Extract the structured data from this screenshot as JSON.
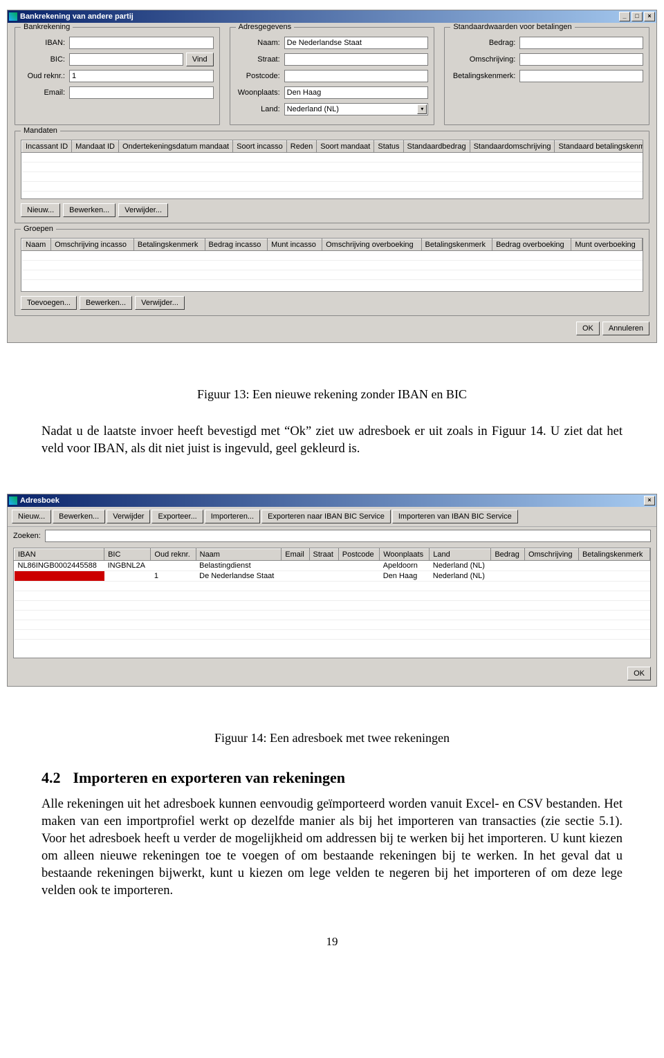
{
  "figure13": {
    "window_title": "Bankrekening van andere partij",
    "groups": {
      "bankrekening": {
        "title": "Bankrekening",
        "fields": {
          "iban_label": "IBAN:",
          "iban_value": "",
          "bic_label": "BIC:",
          "bic_value": "",
          "vind_btn": "Vind",
          "oudreknr_label": "Oud reknr.:",
          "oudreknr_value": "1",
          "email_label": "Email:",
          "email_value": ""
        }
      },
      "adres": {
        "title": "Adresgegevens",
        "fields": {
          "naam_label": "Naam:",
          "naam_value": "De Nederlandse Staat",
          "straat_label": "Straat:",
          "straat_value": "",
          "postcode_label": "Postcode:",
          "postcode_value": "",
          "woonplaats_label": "Woonplaats:",
          "woonplaats_value": "Den Haag",
          "land_label": "Land:",
          "land_value": "Nederland (NL)"
        }
      },
      "standaard": {
        "title": "Standaardwaarden voor betalingen",
        "fields": {
          "bedrag_label": "Bedrag:",
          "bedrag_value": "",
          "omschrijving_label": "Omschrijving:",
          "omschrijving_value": "",
          "betkenm_label": "Betalingskenmerk:",
          "betkenm_value": ""
        }
      },
      "mandaten": {
        "title": "Mandaten",
        "cols": [
          "Incassant ID",
          "Mandaat ID",
          "Ondertekeningsdatum mandaat",
          "Soort incasso",
          "Reden",
          "Soort mandaat",
          "Status",
          "Standaardbedrag",
          "Standaardomschrijving",
          "Standaard betalingskenmerk"
        ],
        "btns": {
          "nieuw": "Nieuw...",
          "bewerken": "Bewerken...",
          "verwijder": "Verwijder..."
        }
      },
      "groepen": {
        "title": "Groepen",
        "cols": [
          "Naam",
          "Omschrijving incasso",
          "Betalingskenmerk",
          "Bedrag incasso",
          "Munt incasso",
          "Omschrijving overboeking",
          "Betalingskenmerk",
          "Bedrag overboeking",
          "Munt overboeking"
        ],
        "btns": {
          "toevoegen": "Toevoegen...",
          "bewerken": "Bewerken...",
          "verwijder": "Verwijder..."
        }
      }
    },
    "ok_btn": "OK",
    "cancel_btn": "Annuleren",
    "caption": "Figuur 13: Een nieuwe rekening zonder IBAN en BIC"
  },
  "para1": "Nadat u de laatste invoer heeft bevestigd met “Ok” ziet uw adresboek er uit zoals in Figuur 14. U ziet dat het veld voor IBAN, als dit niet juist is ingevuld, geel gekleurd is.",
  "figure14": {
    "window_title": "Adresboek",
    "toolbar": [
      "Nieuw...",
      "Bewerken...",
      "Verwijder",
      "Exporteer...",
      "Importeren...",
      "Exporteren naar IBAN BIC Service",
      "Importeren van IBAN BIC Service"
    ],
    "zoeken_label": "Zoeken:",
    "cols": [
      "IBAN",
      "BIC",
      "Oud reknr.",
      "Naam",
      "Email",
      "Straat",
      "Postcode",
      "Woonplaats",
      "Land",
      "Bedrag",
      "Omschrijving",
      "Betalingskenmerk"
    ],
    "rows": [
      {
        "iban": "NL86INGB0002445588",
        "bic": "INGBNL2A",
        "oud": "",
        "naam": "Belastingdienst",
        "email": "",
        "straat": "",
        "postcode": "",
        "woonplaats": "Apeldoorn",
        "land": "Nederland (NL)",
        "bedrag": "",
        "omschrijving": "",
        "betkenm": ""
      },
      {
        "iban": "",
        "bic": "",
        "oud": "1",
        "naam": "De Nederlandse Staat",
        "email": "",
        "straat": "",
        "postcode": "",
        "woonplaats": "Den Haag",
        "land": "Nederland (NL)",
        "bedrag": "",
        "omschrijving": "",
        "betkenm": "",
        "iban_red": true
      }
    ],
    "ok_btn": "OK",
    "caption": "Figuur 14: Een adresboek met twee rekeningen"
  },
  "section": {
    "num": "4.2",
    "title": "Importeren en exporteren van rekeningen"
  },
  "para2": "Alle rekeningen uit het adresboek kunnen eenvoudig geïmporteerd worden vanuit Excel- en CSV bestanden. Het maken van een importprofiel werkt op dezelfde manier als bij het importeren van transacties (zie sectie 5.1). Voor het adresboek heeft u verder de mogelijkheid om addressen bij te werken bij het importeren. U kunt kiezen om alleen nieuwe rekeningen toe te voegen of om bestaande rekeningen bij te werken. In het geval dat u bestaande rekeningen bijwerkt, kunt u kiezen om lege velden te negeren bij het importeren of om deze lege velden ook te importeren.",
  "page_number": "19"
}
